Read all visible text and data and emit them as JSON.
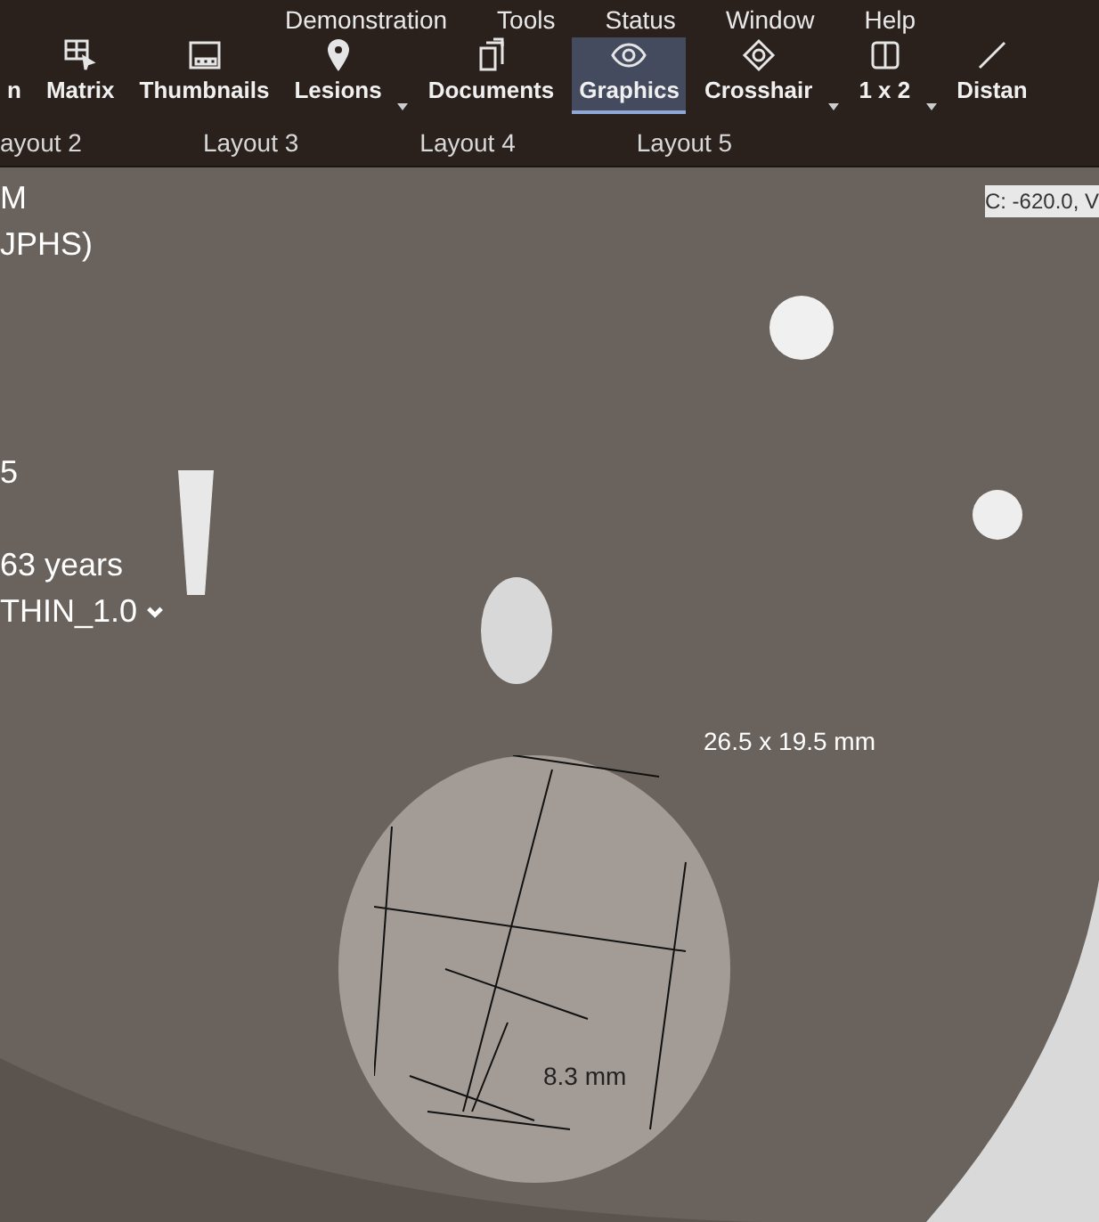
{
  "menu": [
    "Demonstration",
    "Tools",
    "Status",
    "Window",
    "Help"
  ],
  "toolbar": [
    {
      "label": "n",
      "selected": false,
      "dropdown": false
    },
    {
      "label": "Matrix",
      "selected": false,
      "dropdown": false
    },
    {
      "label": "Thumbnails",
      "selected": false,
      "dropdown": false
    },
    {
      "label": "Lesions",
      "selected": false,
      "dropdown": true
    },
    {
      "label": "Documents",
      "selected": false,
      "dropdown": false
    },
    {
      "label": "Graphics",
      "selected": true,
      "dropdown": false
    },
    {
      "label": "Crosshair",
      "selected": false,
      "dropdown": true
    },
    {
      "label": "1 x 2",
      "selected": false,
      "dropdown": true
    },
    {
      "label": "Distan",
      "selected": false,
      "dropdown": false
    }
  ],
  "layouts": [
    {
      "label": "ayout 2",
      "selected": false
    },
    {
      "label": "Layout 3",
      "selected": false
    },
    {
      "label": "Layout 4",
      "selected": false
    },
    {
      "label": "Layout 5",
      "selected": false
    }
  ],
  "viewer": {
    "overlay_left": [
      {
        "text": "M",
        "dropdown": false
      },
      {
        "text": "JPHS)",
        "dropdown": false
      },
      {
        "text": "5",
        "dropdown": false
      },
      {
        "text": "63 years",
        "dropdown": false
      },
      {
        "text": "THIN_1.0",
        "dropdown": true
      }
    ],
    "overlay_right": "C: -620.0, V",
    "measurements": [
      "26.5 x 19.5 mm",
      "8.3 mm"
    ]
  }
}
